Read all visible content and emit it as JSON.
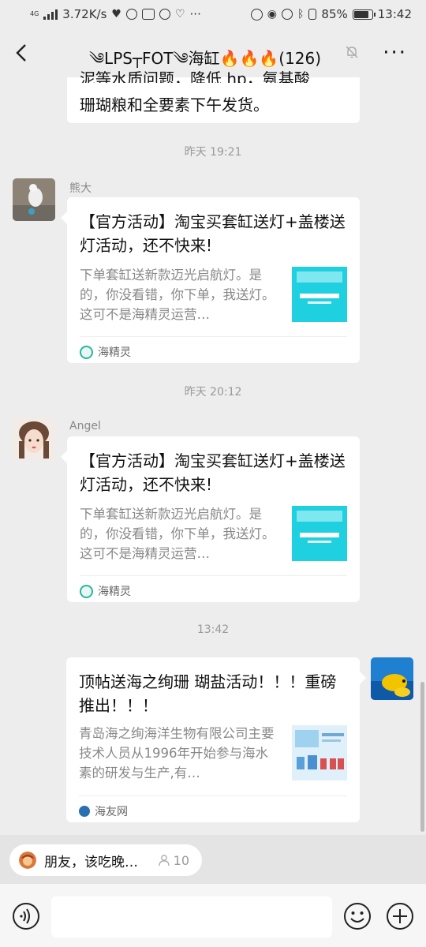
{
  "status_bar": {
    "network_type": "4G",
    "speed": "3.72K/s",
    "battery": "85%",
    "battery_level": 0.85,
    "time": "13:42"
  },
  "header": {
    "title": "༄LPS┬FOT༄海缸🔥🔥🔥(126)",
    "icons": [
      "back-arrow-icon",
      "mute-bell-icon",
      "more-dots-icon"
    ]
  },
  "feed": {
    "truncated_message": {
      "line1": "泥等水质问题，降低 hp，氨基酸",
      "line2": "珊瑚粮和全要素下午发货。"
    },
    "groups": [
      {
        "timestamp": "昨天 19:21",
        "sender": "熊大",
        "card": {
          "title": "【官方活动】淘宝买套缸送灯+盖楼送灯活动，还不快来!",
          "description": "下单套缸送新款迈光启航灯。是的，你没看错，你下单，我送灯。这可不是海精灵运营…",
          "source": "海精灵"
        }
      },
      {
        "timestamp": "昨天 20:12",
        "sender": "Angel",
        "card": {
          "title": "【官方活动】淘宝买套缸送灯+盖楼送灯活动，还不快来!",
          "description": "下单套缸送新款迈光启航灯。是的，你没看错，你下单，我送灯。这可不是海精灵运营…",
          "source": "海精灵"
        }
      },
      {
        "timestamp": "13:42",
        "card": {
          "title": "顶帖送海之绚珊 瑚盐活动！！！重磅推出！！！",
          "description": "青岛海之绚海洋生物有限公司主要技术人员从1996年开始参与海水素的研发与生产,有…",
          "source": "海友网"
        }
      }
    ]
  },
  "notice": {
    "text": "朋友，该吃晚…",
    "count": "10"
  },
  "colors": {
    "background": "#ededed",
    "bubble": "#ffffff",
    "thumb_cyan": "#1fd0e0",
    "source_green": "#2bb5a0"
  }
}
